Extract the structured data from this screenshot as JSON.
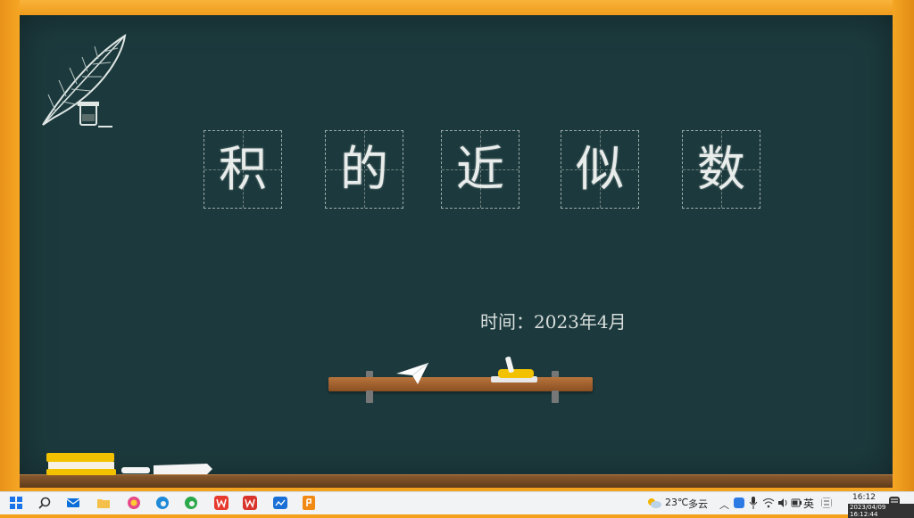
{
  "slide": {
    "title_chars": [
      "积",
      "的",
      "近",
      "似",
      "数"
    ],
    "date_line": "时间：2023年4月"
  },
  "taskbar": {
    "apps": [
      "start-icon",
      "search-icon",
      "mail-icon",
      "file-explorer-icon",
      "color-app-icon",
      "edge-icon",
      "edge-dev-icon",
      "wps-icon",
      "wps-writer-icon",
      "media-icon",
      "ppt-icon"
    ],
    "weather_temp": "23℃",
    "weather_desc": "多云",
    "ime": "英",
    "time": "16:12",
    "date_stamp": "2023/04/09 16:12:44"
  },
  "colors": {
    "board": "#1c3a3d",
    "frame": "#f2a21e",
    "chalk": "#e8ecea"
  }
}
